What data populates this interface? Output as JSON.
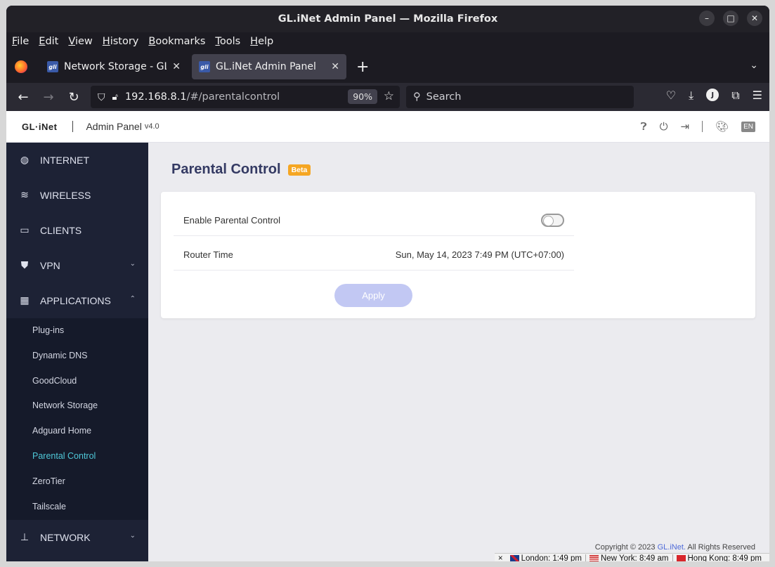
{
  "window": {
    "title": "GL.iNet Admin Panel — Mozilla Firefox",
    "wm": {
      "minimize": "–",
      "maximize": "□",
      "close": "✕"
    }
  },
  "menubar": [
    "File",
    "Edit",
    "View",
    "History",
    "Bookmarks",
    "Tools",
    "Help"
  ],
  "tabs": [
    {
      "label": "Network Storage - GL.iNe",
      "close": "✕",
      "active": false
    },
    {
      "label": "GL.iNet Admin Panel",
      "close": "✕",
      "active": true
    }
  ],
  "tab_favicon_text": "gli",
  "new_tab": "+",
  "navbar": {
    "url_host": "192.168.8.1",
    "url_path": "/#/parentalcontrol",
    "zoom": "90%",
    "search_placeholder": "Search",
    "account_initial": "J"
  },
  "app": {
    "brand": "GL·iNet",
    "title": "Admin Panel",
    "version": "v4.0",
    "lang": "EN"
  },
  "sidebar": {
    "items": [
      {
        "label": "INTERNET",
        "icon": "globe-icon"
      },
      {
        "label": "WIRELESS",
        "icon": "wifi-icon"
      },
      {
        "label": "CLIENTS",
        "icon": "devices-icon"
      },
      {
        "label": "VPN",
        "icon": "shield-icon"
      },
      {
        "label": "APPLICATIONS",
        "icon": "apps-icon"
      },
      {
        "label": "NETWORK",
        "icon": "network-icon"
      }
    ],
    "submenu": [
      "Plug-ins",
      "Dynamic DNS",
      "GoodCloud",
      "Network Storage",
      "Adguard Home",
      "Parental Control",
      "ZeroTier",
      "Tailscale"
    ],
    "active_sub": "Parental Control"
  },
  "main": {
    "title": "Parental Control",
    "badge": "Beta",
    "enable_label": "Enable Parental Control",
    "enable_value": false,
    "router_time_label": "Router Time",
    "router_time_value": "Sun, May 14, 2023 7:49 PM (UTC+07:00)",
    "apply_label": "Apply"
  },
  "footer": {
    "copyright_prefix": "Copyright © 2023",
    "copyright_link": "GL.iNet.",
    "copyright_suffix": "All Rights Reserved"
  },
  "statusbar": {
    "close": "×",
    "london": "London: 1:49 pm",
    "newyork": "New York: 8:49 am",
    "hongkong": "Hong Kong: 8:49 pm"
  },
  "colors": {
    "sidebar_bg": "#1d2235",
    "active_sub": "#4fc8d8",
    "title": "#343a63",
    "beta": "#f5a623",
    "apply": "#c2c8f3"
  }
}
